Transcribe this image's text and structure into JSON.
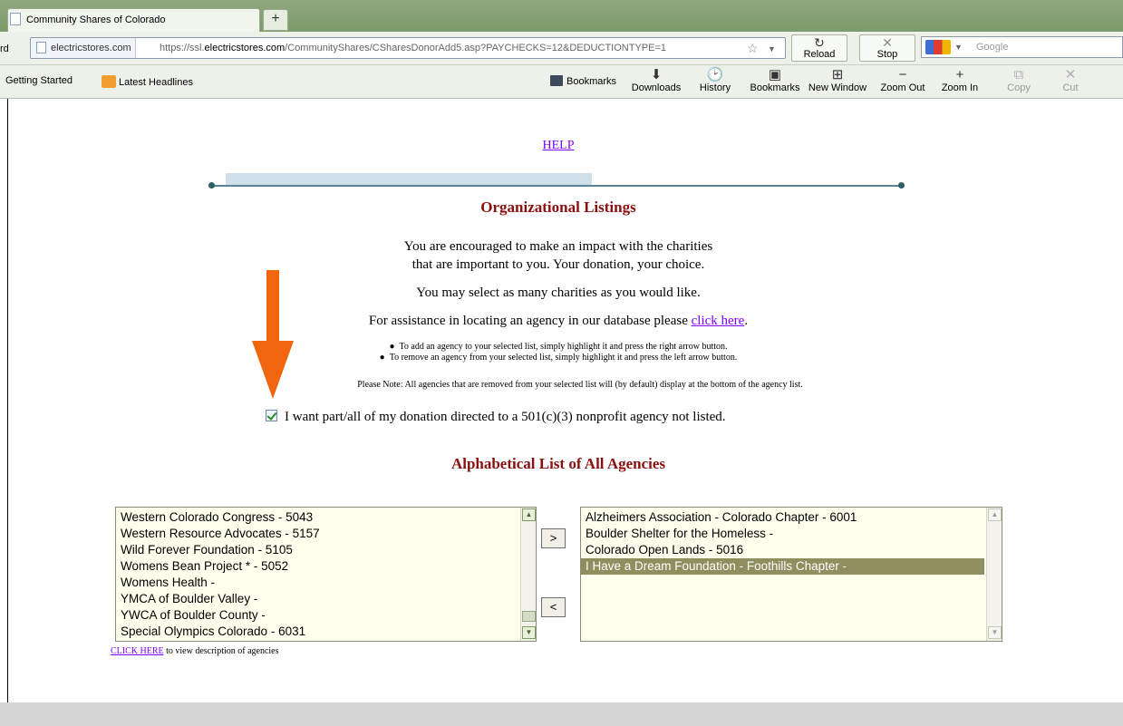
{
  "browser": {
    "tab_title": "Community Shares of Colorado",
    "new_tab": "+",
    "nav_left_fragment": "rd",
    "site_identity": "electricstores.com",
    "url_prefix": "https://ssl.",
    "url_domain": "electricstores.com",
    "url_path": "/CommunityShares/CSharesDonorAdd5.asp?PAYCHECKS=12&DEDUCTIONTYPE=1",
    "reload_label": "Reload",
    "stop_label": "Stop",
    "search_placeholder": "Google",
    "bookmarks": {
      "getting_started": "Getting Started",
      "latest_headlines": "Latest Headlines"
    },
    "toolbar": {
      "bookmarks_menu": "Bookmarks",
      "downloads": "Downloads",
      "history": "History",
      "bookmarks": "Bookmarks",
      "new_window": "New Window",
      "zoom_out": "Zoom Out",
      "zoom_in": "Zoom In",
      "copy": "Copy",
      "cut": "Cut"
    }
  },
  "page": {
    "help_link": "HELP",
    "progress_fraction": 0.53,
    "title": "Organizational Listings",
    "intro_line1": "You are encouraged to make an impact with the charities",
    "intro_line2": "that are important to you. Your donation, your choice.",
    "select_many": "You may select as many charities as you would like.",
    "assist_prefix": "For assistance in locating an agency in our database please ",
    "assist_link": "click here",
    "assist_suffix": ".",
    "bullet_add": "To add an agency to your selected list, simply highlight it and press the right arrow button.",
    "bullet_remove": "To remove an agency from your selected list, simply highlight it and press the left arrow button.",
    "note": "Please Note: All agencies that are removed from your selected list will (by default) display at the bottom of the agency list.",
    "checkbox_label": "I want part/all of my donation directed to a 501(c)(3) nonprofit agency not listed.",
    "checkbox_checked": true,
    "list_heading": "Alphabetical List of All Agencies",
    "available_agencies": [
      "Western Colorado Congress - 5043",
      "Western Resource Advocates - 5157",
      "Wild Forever Foundation - 5105",
      "Womens Bean Project * - 5052",
      "Womens Health -",
      "YMCA of Boulder Valley -",
      "YWCA of Boulder County -",
      "Special Olympics Colorado - 6031"
    ],
    "selected_agencies": [
      "Alzheimers Association - Colorado Chapter - 6001",
      "Boulder Shelter for the Homeless -",
      "Colorado Open Lands - 5016",
      "I Have a Dream Foundation - Foothills Chapter -"
    ],
    "selected_highlight_index": 3,
    "add_button": ">",
    "remove_button": "<",
    "footer_link": "CLICK HERE",
    "footer_text": " to view description of agencies"
  },
  "colors": {
    "heading": "#8b0f0f",
    "link": "#7f00ff",
    "arrow_annotation": "#f2650f",
    "listbox_bg": "#ffffee",
    "list_selected": "#8e8e5e"
  }
}
